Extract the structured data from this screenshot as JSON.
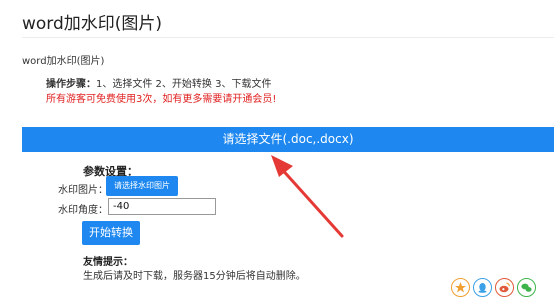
{
  "page": {
    "title": "word加水印(图片)",
    "subtitle": "word加水印(图片)",
    "steps_label": "操作步骤：",
    "steps_text": "1、选择文件 2、开始转换 3、下载文件",
    "notice": "所有游客可免费使用3次，如有更多需要请开通会员!"
  },
  "select_file": {
    "label": "请选择文件(.doc,.docx)"
  },
  "params": {
    "heading": "参数设置：",
    "watermark_label": "水印图片：",
    "watermark_button": "请选择水印图片",
    "angle_label": "水印角度：",
    "angle_value": "-40"
  },
  "start_button": {
    "label": "开始转换"
  },
  "tips": {
    "heading": "友情提示：",
    "text": "生成后请及时下载，服务器15分钟后将自动删除。"
  },
  "share_icons": [
    "star-icon",
    "qq-icon",
    "weibo-icon",
    "wechat-icon"
  ],
  "colors": {
    "accent": "#1e88f0",
    "notice": "#e02020",
    "arrow": "#e53935"
  }
}
